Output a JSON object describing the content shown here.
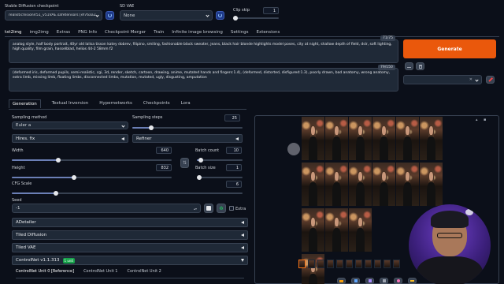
{
  "top": {
    "checkpoint_label": "Stable Diffusion checkpoint",
    "checkpoint_value": "realisticVisionV51_v51VAE.safetensors [ef76aa2",
    "vae_label": "SD VAE",
    "vae_value": "None",
    "clip_label": "Clip skip",
    "clip_value": "1"
  },
  "tabs": [
    "txt2img",
    "img2img",
    "Extras",
    "PNG Info",
    "Checkpoint Merger",
    "Train",
    "Infinite image browsing",
    "Settings",
    "Extensions"
  ],
  "prompt": {
    "counter": "71/75",
    "text": "analog style, half body portrait, 40yr old lalisa tisson katey dobrev, filipino,  smiling, fashionable black sweater, jeans, black hair blonde highlights model poses, city at night, shallow depth of field, dslr, soft lighting, high quality, film grain, hasselblad, helios 44-2 58mm f2"
  },
  "negative": {
    "counter": "79/150",
    "text": "(deformed iris, deformed pupils, semi-realistic, cgi, 3d, render, sketch, cartoon, drawing, anime, mutated hands and fingers:1.4), (deformed, distorted, disfigured:1.3), poorly drawn, bad anatomy, wrong anatomy, extra limb, missing limb, floating limbs, disconnected limbs, mutation, mutated, ugly, disgusting, amputation"
  },
  "generate_label": "Generate",
  "subtabs": [
    "Generation",
    "Textual Inversion",
    "Hypernetworks",
    "Checkpoints",
    "Lora"
  ],
  "params": {
    "sampling_method_label": "Sampling method",
    "sampling_method": "Euler a",
    "sampling_steps_label": "Sampling steps",
    "sampling_steps": "25",
    "hires_label": "Hires. fix",
    "refiner_label": "Refiner",
    "width_label": "Width",
    "width": "640",
    "height_label": "Height",
    "height": "832",
    "batch_count_label": "Batch count",
    "batch_count": "10",
    "batch_size_label": "Batch size",
    "batch_size": "1",
    "cfg_label": "CFG Scale",
    "cfg": "6",
    "seed_label": "Seed",
    "seed": "-1",
    "extra_label": "Extra",
    "steps_fill": 0.17,
    "width_fill": 0.29,
    "height_fill": 0.39,
    "batch_count_fill": 0.09,
    "batch_size_fill": 0.0,
    "cfg_fill": 0.19
  },
  "accordions": [
    "ADetailer",
    "Tiled Diffusion",
    "Tiled VAE"
  ],
  "controlnet": {
    "title": "ControlNet v1.1.313",
    "badge": "1 unit",
    "units": [
      "ControlNet Unit 0 [Reference]",
      "ControlNet Unit 1",
      "ControlNet Unit 2"
    ]
  },
  "colors": {
    "accent": "#f97316",
    "bg": "#0b0f19",
    "panel": "#1f2937"
  }
}
